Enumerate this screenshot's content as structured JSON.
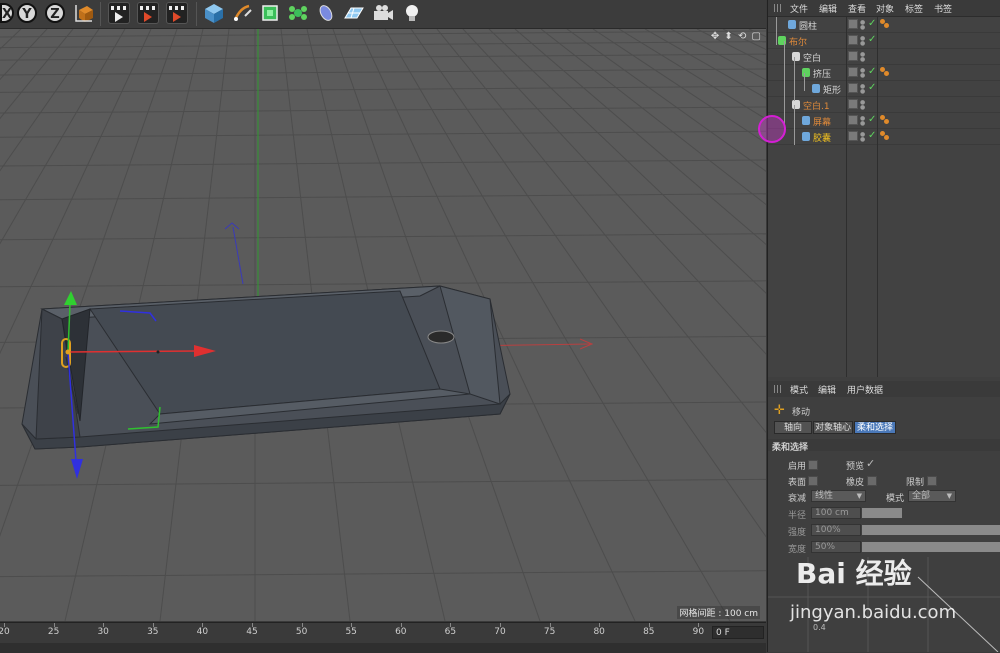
{
  "toolbar": {
    "axis_buttons": [
      "Y",
      "Z"
    ],
    "icons": [
      "coordinate-icon",
      "clapper-render-icon",
      "clapper-render-view-icon",
      "clapper-settings-icon",
      "cube-icon",
      "pen-icon",
      "subdivision-icon",
      "cloner-icon",
      "deformer-icon",
      "floor-icon",
      "camera-icon",
      "light-icon"
    ]
  },
  "viewport": {
    "grid_spacing_label": "网格间距 : 100 cm",
    "nav_icons": "✥ ⬍ ⟲ ▢"
  },
  "timeline": {
    "ticks": [
      "20",
      "25",
      "30",
      "35",
      "40",
      "45",
      "50",
      "55",
      "60",
      "65",
      "70",
      "75",
      "80",
      "85",
      "90"
    ],
    "current_frame": "0 F"
  },
  "object_manager": {
    "menu": [
      "文件",
      "编辑",
      "查看",
      "对象",
      "标签",
      "书签"
    ],
    "rows": [
      {
        "name": "圆柱",
        "color": "#d8d8d8",
        "icon_color": "#6fa8dc"
      },
      {
        "name": "布尔",
        "color": "#e08a3a",
        "icon_color": "#5fd35f"
      },
      {
        "name": "空白",
        "color": "#d8d8d8",
        "icon_color": "#d8d8d8"
      },
      {
        "name": "挤压",
        "color": "#d8d8d8",
        "icon_color": "#5fd35f"
      },
      {
        "name": "矩形",
        "color": "#d8d8d8",
        "icon_color": "#6fa8dc"
      },
      {
        "name": "空白.1",
        "color": "#e08a3a",
        "icon_color": "#d8d8d8"
      },
      {
        "name": "屏幕",
        "color": "#e08a3a",
        "icon_color": "#6fa8dc"
      },
      {
        "name": "胶囊",
        "color": "#f0c020",
        "icon_color": "#6fa8dc"
      }
    ]
  },
  "attributes": {
    "menu": [
      "模式",
      "编辑",
      "用户数据"
    ],
    "tool_name": "移动",
    "tabs": [
      "轴向",
      "对象轴心",
      "柔和选择"
    ],
    "active_tab": "柔和选择",
    "section_title": "柔和选择",
    "enable_label": "启用",
    "preview_label": "预览",
    "surface_label": "表面",
    "rubber_label": "橡皮",
    "restrict_label": "限制",
    "falloff_label": "衰减",
    "falloff_value": "线性",
    "mode_label": "模式",
    "mode_value": "全部",
    "radius_label": "半径",
    "radius_value": "100 cm",
    "strength_label": "强度",
    "strength_value": "100%",
    "width_label": "宽度",
    "width_value": "50%",
    "graph_label": "0.4"
  },
  "watermark": {
    "logo": "Bai 经验",
    "url": "jingyan.baidu.com"
  }
}
